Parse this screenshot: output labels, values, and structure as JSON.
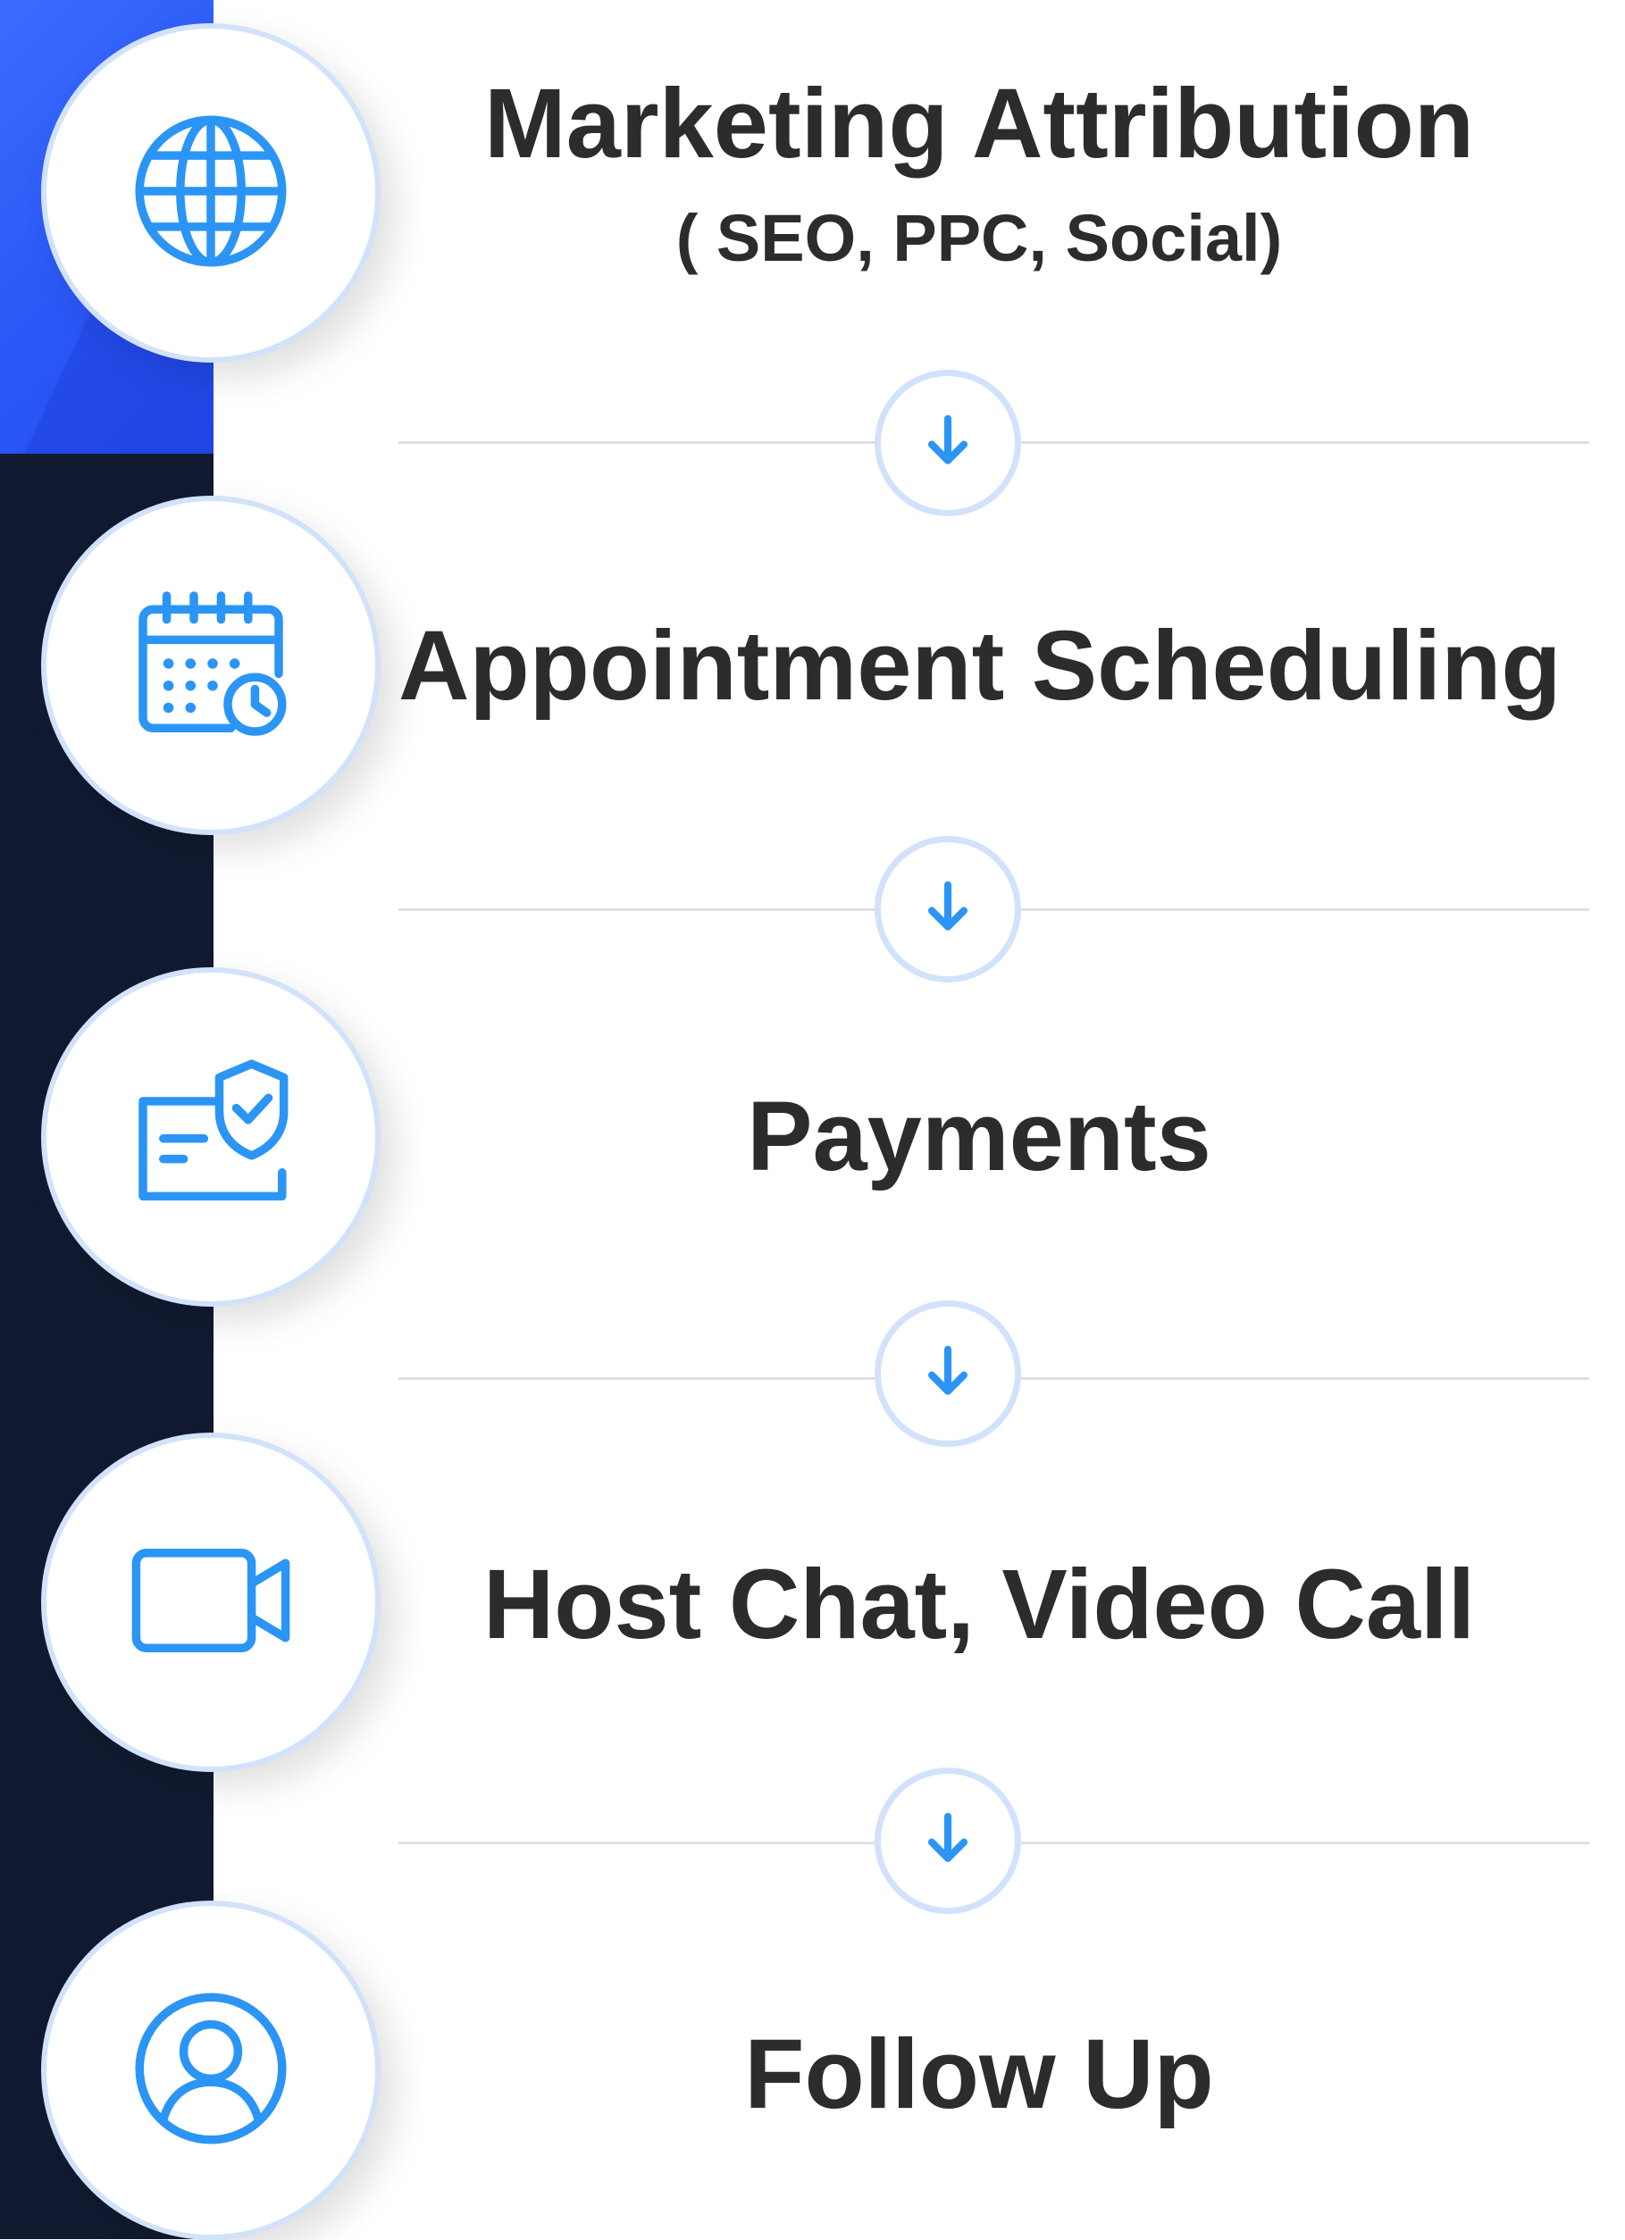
{
  "steps": [
    {
      "title": "Marketing Attribution",
      "subtitle": "( SEO, PPC, Social)",
      "icon": "globe-icon"
    },
    {
      "title": "Appointment Scheduling",
      "icon": "calendar-clock-icon"
    },
    {
      "title": "Payments",
      "icon": "secure-card-icon"
    },
    {
      "title": "Host Chat, Video Call",
      "icon": "video-camera-icon"
    },
    {
      "title": "Follow Up",
      "icon": "user-profile-icon"
    }
  ],
  "connector_icon": "arrow-down-icon",
  "colors": {
    "accent": "#2b95f5",
    "circle_border": "#d2e2fb",
    "text": "#2c2c2c",
    "band_dark": "#111a30",
    "band_blue": "#2b5cf6",
    "divider": "#dde1e7"
  }
}
